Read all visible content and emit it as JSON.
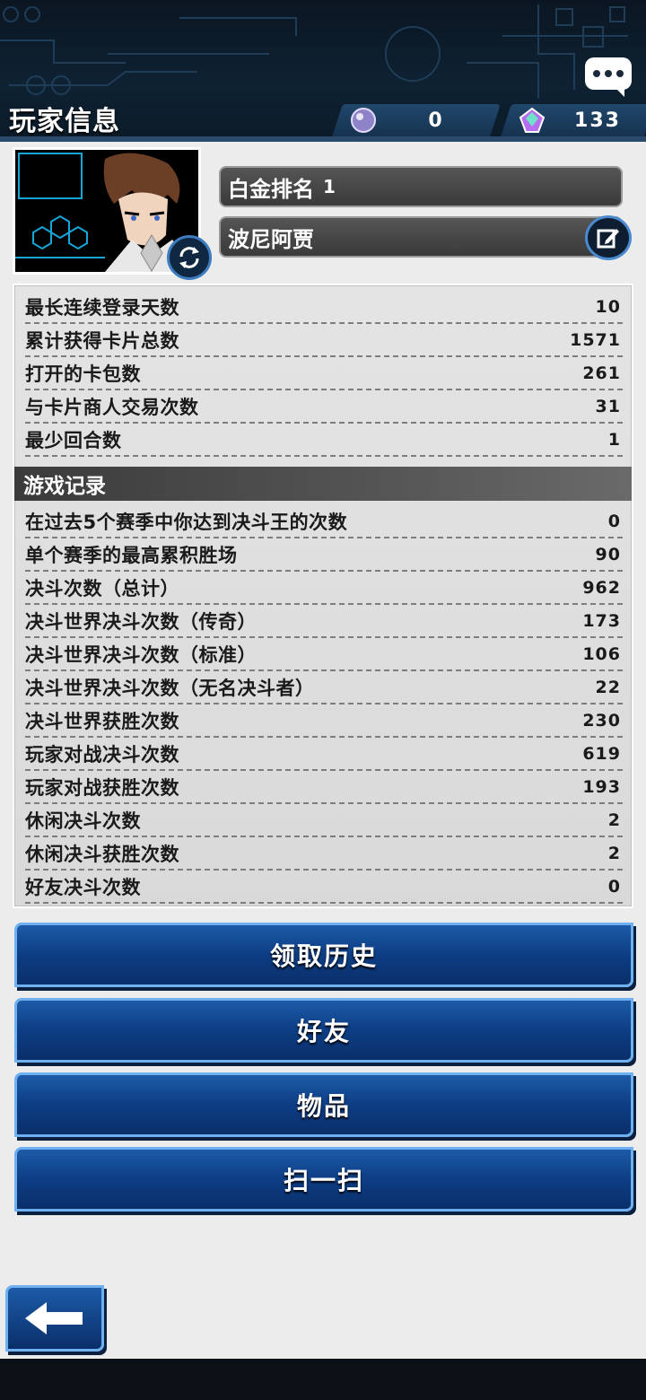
{
  "header": {
    "title": "玩家信息",
    "currency": [
      {
        "icon": "purple-orb-icon",
        "value": "0"
      },
      {
        "icon": "rainbow-gem-icon",
        "value": "133"
      }
    ]
  },
  "profile": {
    "rank_label": "白金排名",
    "rank_value": "1",
    "name": "波尼阿贾"
  },
  "stats": [
    {
      "label": "最长连续登录天数",
      "value": "10"
    },
    {
      "label": "累计获得卡片总数",
      "value": "1571"
    },
    {
      "label": "打开的卡包数",
      "value": "261"
    },
    {
      "label": "与卡片商人交易次数",
      "value": "31"
    },
    {
      "label": "最少回合数",
      "value": "1"
    }
  ],
  "game_record": {
    "title": "游戏记录",
    "rows": [
      {
        "label": "在过去5个赛季中你达到决斗王的次数",
        "value": "0"
      },
      {
        "label": "单个赛季的最高累积胜场",
        "value": "90"
      },
      {
        "label": "决斗次数（总计）",
        "value": "962"
      },
      {
        "label": "决斗世界决斗次数（传奇）",
        "value": "173"
      },
      {
        "label": "决斗世界决斗次数（标准）",
        "value": "106"
      },
      {
        "label": "决斗世界决斗次数（无名决斗者）",
        "value": "22"
      },
      {
        "label": "决斗世界获胜次数",
        "value": "230"
      },
      {
        "label": "玩家对战决斗次数",
        "value": "619"
      },
      {
        "label": "玩家对战获胜次数",
        "value": "193"
      },
      {
        "label": "休闲决斗次数",
        "value": "2"
      },
      {
        "label": "休闲决斗获胜次数",
        "value": "2"
      },
      {
        "label": "好友决斗次数",
        "value": "0"
      }
    ]
  },
  "buttons": {
    "history": "领取历史",
    "friends": "好友",
    "items": "物品",
    "scan": "扫一扫"
  }
}
